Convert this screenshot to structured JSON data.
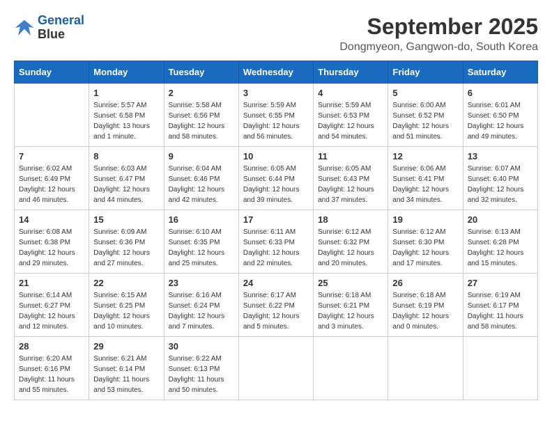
{
  "header": {
    "logo_line1": "General",
    "logo_line2": "Blue",
    "title": "September 2025",
    "subtitle": "Dongmyeon, Gangwon-do, South Korea"
  },
  "weekdays": [
    "Sunday",
    "Monday",
    "Tuesday",
    "Wednesday",
    "Thursday",
    "Friday",
    "Saturday"
  ],
  "weeks": [
    [
      {
        "day": "",
        "sunrise": "",
        "sunset": "",
        "daylight": ""
      },
      {
        "day": "1",
        "sunrise": "Sunrise: 5:57 AM",
        "sunset": "Sunset: 6:58 PM",
        "daylight": "Daylight: 13 hours and 1 minute."
      },
      {
        "day": "2",
        "sunrise": "Sunrise: 5:58 AM",
        "sunset": "Sunset: 6:56 PM",
        "daylight": "Daylight: 12 hours and 58 minutes."
      },
      {
        "day": "3",
        "sunrise": "Sunrise: 5:59 AM",
        "sunset": "Sunset: 6:55 PM",
        "daylight": "Daylight: 12 hours and 56 minutes."
      },
      {
        "day": "4",
        "sunrise": "Sunrise: 5:59 AM",
        "sunset": "Sunset: 6:53 PM",
        "daylight": "Daylight: 12 hours and 54 minutes."
      },
      {
        "day": "5",
        "sunrise": "Sunrise: 6:00 AM",
        "sunset": "Sunset: 6:52 PM",
        "daylight": "Daylight: 12 hours and 51 minutes."
      },
      {
        "day": "6",
        "sunrise": "Sunrise: 6:01 AM",
        "sunset": "Sunset: 6:50 PM",
        "daylight": "Daylight: 12 hours and 49 minutes."
      }
    ],
    [
      {
        "day": "7",
        "sunrise": "Sunrise: 6:02 AM",
        "sunset": "Sunset: 6:49 PM",
        "daylight": "Daylight: 12 hours and 46 minutes."
      },
      {
        "day": "8",
        "sunrise": "Sunrise: 6:03 AM",
        "sunset": "Sunset: 6:47 PM",
        "daylight": "Daylight: 12 hours and 44 minutes."
      },
      {
        "day": "9",
        "sunrise": "Sunrise: 6:04 AM",
        "sunset": "Sunset: 6:46 PM",
        "daylight": "Daylight: 12 hours and 42 minutes."
      },
      {
        "day": "10",
        "sunrise": "Sunrise: 6:05 AM",
        "sunset": "Sunset: 6:44 PM",
        "daylight": "Daylight: 12 hours and 39 minutes."
      },
      {
        "day": "11",
        "sunrise": "Sunrise: 6:05 AM",
        "sunset": "Sunset: 6:43 PM",
        "daylight": "Daylight: 12 hours and 37 minutes."
      },
      {
        "day": "12",
        "sunrise": "Sunrise: 6:06 AM",
        "sunset": "Sunset: 6:41 PM",
        "daylight": "Daylight: 12 hours and 34 minutes."
      },
      {
        "day": "13",
        "sunrise": "Sunrise: 6:07 AM",
        "sunset": "Sunset: 6:40 PM",
        "daylight": "Daylight: 12 hours and 32 minutes."
      }
    ],
    [
      {
        "day": "14",
        "sunrise": "Sunrise: 6:08 AM",
        "sunset": "Sunset: 6:38 PM",
        "daylight": "Daylight: 12 hours and 29 minutes."
      },
      {
        "day": "15",
        "sunrise": "Sunrise: 6:09 AM",
        "sunset": "Sunset: 6:36 PM",
        "daylight": "Daylight: 12 hours and 27 minutes."
      },
      {
        "day": "16",
        "sunrise": "Sunrise: 6:10 AM",
        "sunset": "Sunset: 6:35 PM",
        "daylight": "Daylight: 12 hours and 25 minutes."
      },
      {
        "day": "17",
        "sunrise": "Sunrise: 6:11 AM",
        "sunset": "Sunset: 6:33 PM",
        "daylight": "Daylight: 12 hours and 22 minutes."
      },
      {
        "day": "18",
        "sunrise": "Sunrise: 6:12 AM",
        "sunset": "Sunset: 6:32 PM",
        "daylight": "Daylight: 12 hours and 20 minutes."
      },
      {
        "day": "19",
        "sunrise": "Sunrise: 6:12 AM",
        "sunset": "Sunset: 6:30 PM",
        "daylight": "Daylight: 12 hours and 17 minutes."
      },
      {
        "day": "20",
        "sunrise": "Sunrise: 6:13 AM",
        "sunset": "Sunset: 6:28 PM",
        "daylight": "Daylight: 12 hours and 15 minutes."
      }
    ],
    [
      {
        "day": "21",
        "sunrise": "Sunrise: 6:14 AM",
        "sunset": "Sunset: 6:27 PM",
        "daylight": "Daylight: 12 hours and 12 minutes."
      },
      {
        "day": "22",
        "sunrise": "Sunrise: 6:15 AM",
        "sunset": "Sunset: 6:25 PM",
        "daylight": "Daylight: 12 hours and 10 minutes."
      },
      {
        "day": "23",
        "sunrise": "Sunrise: 6:16 AM",
        "sunset": "Sunset: 6:24 PM",
        "daylight": "Daylight: 12 hours and 7 minutes."
      },
      {
        "day": "24",
        "sunrise": "Sunrise: 6:17 AM",
        "sunset": "Sunset: 6:22 PM",
        "daylight": "Daylight: 12 hours and 5 minutes."
      },
      {
        "day": "25",
        "sunrise": "Sunrise: 6:18 AM",
        "sunset": "Sunset: 6:21 PM",
        "daylight": "Daylight: 12 hours and 3 minutes."
      },
      {
        "day": "26",
        "sunrise": "Sunrise: 6:18 AM",
        "sunset": "Sunset: 6:19 PM",
        "daylight": "Daylight: 12 hours and 0 minutes."
      },
      {
        "day": "27",
        "sunrise": "Sunrise: 6:19 AM",
        "sunset": "Sunset: 6:17 PM",
        "daylight": "Daylight: 11 hours and 58 minutes."
      }
    ],
    [
      {
        "day": "28",
        "sunrise": "Sunrise: 6:20 AM",
        "sunset": "Sunset: 6:16 PM",
        "daylight": "Daylight: 11 hours and 55 minutes."
      },
      {
        "day": "29",
        "sunrise": "Sunrise: 6:21 AM",
        "sunset": "Sunset: 6:14 PM",
        "daylight": "Daylight: 11 hours and 53 minutes."
      },
      {
        "day": "30",
        "sunrise": "Sunrise: 6:22 AM",
        "sunset": "Sunset: 6:13 PM",
        "daylight": "Daylight: 11 hours and 50 minutes."
      },
      {
        "day": "",
        "sunrise": "",
        "sunset": "",
        "daylight": ""
      },
      {
        "day": "",
        "sunrise": "",
        "sunset": "",
        "daylight": ""
      },
      {
        "day": "",
        "sunrise": "",
        "sunset": "",
        "daylight": ""
      },
      {
        "day": "",
        "sunrise": "",
        "sunset": "",
        "daylight": ""
      }
    ]
  ]
}
